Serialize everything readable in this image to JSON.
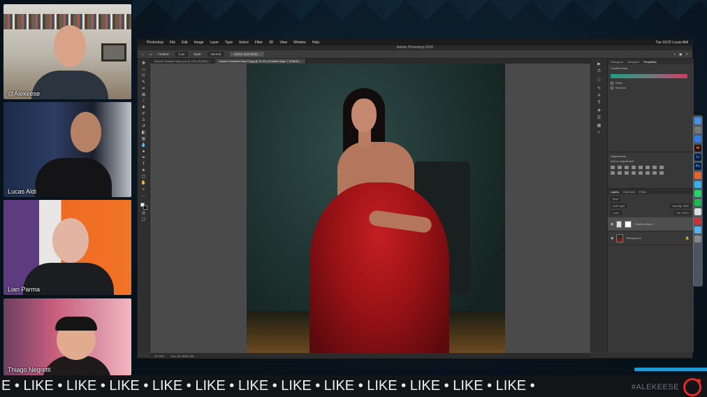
{
  "stream": {
    "participants": [
      {
        "name": "@Alekeese"
      },
      {
        "name": "Lucas Aldi"
      },
      {
        "name": "Lian Parma"
      },
      {
        "name": "Thiago Negretti"
      }
    ],
    "ticker": "E • LIKE • LIKE • LIKE • LIKE • LIKE • LIKE • LIKE • LIKE • LIKE • LIKE • LIKE • LIKE •",
    "brand": "#ALEKEESE"
  },
  "mac_menubar": {
    "apple": "",
    "items": [
      "Photoshop",
      "File",
      "Edit",
      "Image",
      "Layer",
      "Type",
      "Select",
      "Filter",
      "3D",
      "View",
      "Window",
      "Help"
    ],
    "clock": "Tue 18:22   Lucas Aldi"
  },
  "photoshop": {
    "window_title": "Adobe Photoshop 2020",
    "options_bar": {
      "feather_label": "Feather:",
      "feather_value": "0 px",
      "style_label": "Style:",
      "style_value": "Normal",
      "select_mask": "Select and Mask..."
    },
    "doc_tabs": [
      {
        "label": "Modelo Gradient Map.psd @ 16% (RGB/8) ×",
        "active": false
      },
      {
        "label": "Modelo Gradient Map 02.jpg @ 33.3% (Gradient Map 1, RGB/8) ×",
        "active": true
      }
    ],
    "status": {
      "zoom": "33.33%",
      "doc": "Doc: 32.2M/32.2M"
    },
    "panels": {
      "top_tabs": [
        "Histogram",
        "Navigator",
        "Properties"
      ],
      "properties": {
        "title": "Gradient Map",
        "dither": "Dither",
        "reverse": "Reverse"
      },
      "adjustments": {
        "title": "Adjustments",
        "hint": "Add an adjustment"
      },
      "layers": {
        "tabs": [
          "Layers",
          "Channels",
          "Paths"
        ],
        "kind": "Kind",
        "blend": "Soft Light",
        "opacity": "Opacity: 40%",
        "lock": "Lock:",
        "fill": "Fill: 100%",
        "items": [
          {
            "name": "Gradient Map 1",
            "selected": true
          },
          {
            "name": "Background",
            "selected": false
          }
        ]
      }
    }
  },
  "dock_apps": [
    "Lr",
    "Ps",
    "Ai"
  ]
}
